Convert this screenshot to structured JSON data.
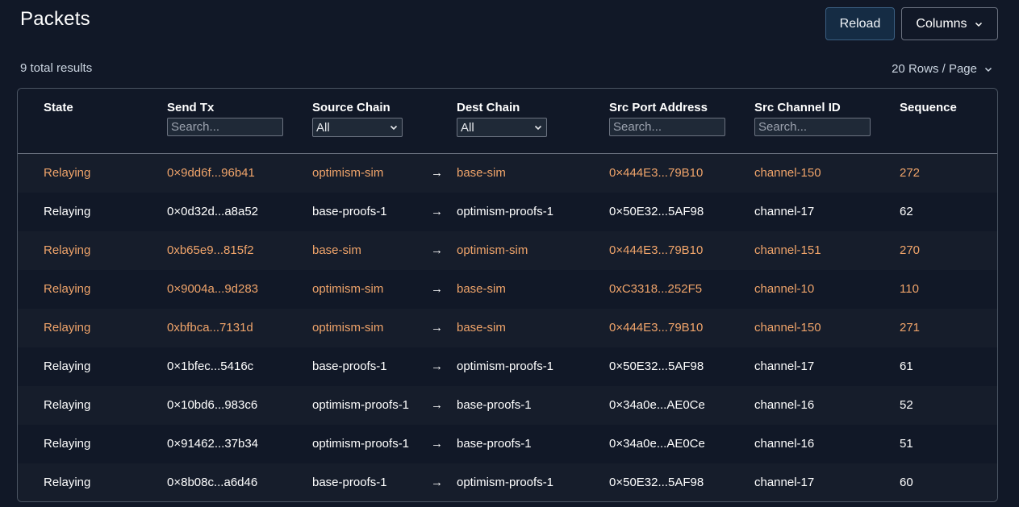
{
  "page": {
    "title": "Packets"
  },
  "toolbar": {
    "reload_label": "Reload",
    "columns_label": "Columns"
  },
  "summary": {
    "total_results": "9 total results",
    "rows_per_page": "20 Rows / Page"
  },
  "table": {
    "headers": {
      "state": "State",
      "send_tx": "Send Tx",
      "source_chain": "Source Chain",
      "dest_chain": "Dest Chain",
      "src_port_address": "Src Port Address",
      "src_channel_id": "Src Channel ID",
      "sequence": "Sequence"
    },
    "filters": {
      "send_tx_placeholder": "Search...",
      "source_chain_value": "All",
      "dest_chain_value": "All",
      "src_port_placeholder": "Search...",
      "src_channel_placeholder": "Search..."
    },
    "arrow": "→",
    "highlight_color": "#f0a46a",
    "rows": [
      {
        "state": "Relaying",
        "send_tx": "0×9dd6f...96b41",
        "source_chain": "optimism-sim",
        "dest_chain": "base-sim",
        "src_port": "0×444E3...79B10",
        "channel": "channel-150",
        "sequence": "272",
        "highlight": true
      },
      {
        "state": "Relaying",
        "send_tx": "0×0d32d...a8a52",
        "source_chain": "base-proofs-1",
        "dest_chain": "optimism-proofs-1",
        "src_port": "0×50E32...5AF98",
        "channel": "channel-17",
        "sequence": "62",
        "highlight": false
      },
      {
        "state": "Relaying",
        "send_tx": "0xb65e9...815f2",
        "source_chain": "base-sim",
        "dest_chain": "optimism-sim",
        "src_port": "0×444E3...79B10",
        "channel": "channel-151",
        "sequence": "270",
        "highlight": true
      },
      {
        "state": "Relaying",
        "send_tx": "0×9004a...9d283",
        "source_chain": "optimism-sim",
        "dest_chain": "base-sim",
        "src_port": "0xC3318...252F5",
        "channel": "channel-10",
        "sequence": "110",
        "highlight": true
      },
      {
        "state": "Relaying",
        "send_tx": "0xbfbca...7131d",
        "source_chain": "optimism-sim",
        "dest_chain": "base-sim",
        "src_port": "0×444E3...79B10",
        "channel": "channel-150",
        "sequence": "271",
        "highlight": true
      },
      {
        "state": "Relaying",
        "send_tx": "0×1bfec...5416c",
        "source_chain": "base-proofs-1",
        "dest_chain": "optimism-proofs-1",
        "src_port": "0×50E32...5AF98",
        "channel": "channel-17",
        "sequence": "61",
        "highlight": false
      },
      {
        "state": "Relaying",
        "send_tx": "0×10bd6...983c6",
        "source_chain": "optimism-proofs-1",
        "dest_chain": "base-proofs-1",
        "src_port": "0×34a0e...AE0Ce",
        "channel": "channel-16",
        "sequence": "52",
        "highlight": false
      },
      {
        "state": "Relaying",
        "send_tx": "0×91462...37b34",
        "source_chain": "optimism-proofs-1",
        "dest_chain": "base-proofs-1",
        "src_port": "0×34a0e...AE0Ce",
        "channel": "channel-16",
        "sequence": "51",
        "highlight": false
      },
      {
        "state": "Relaying",
        "send_tx": "0×8b08c...a6d46",
        "source_chain": "base-proofs-1",
        "dest_chain": "optimism-proofs-1",
        "src_port": "0×50E32...5AF98",
        "channel": "channel-17",
        "sequence": "60",
        "highlight": false
      }
    ]
  }
}
